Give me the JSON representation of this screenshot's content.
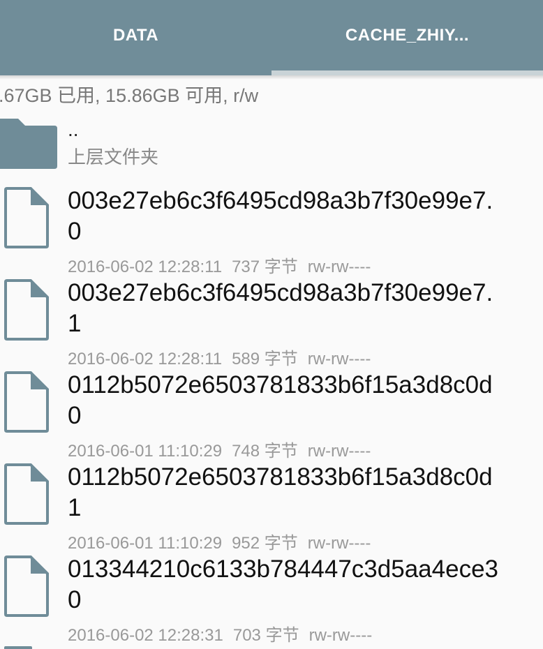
{
  "tabs": {
    "data_label": "DATA",
    "cache_label": "CACHE_ZHIY..."
  },
  "storage_info": ".67GB 已用, 15.86GB 可用, r/w",
  "parent_folder": {
    "name": "..",
    "description": "上层文件夹",
    "icon": "folder-icon"
  },
  "files": [
    {
      "name_line1": "003e27eb6c3f6495cd98a3b7f30e99e7.",
      "name_line2": "0",
      "date": "2016-06-02 12:28:11",
      "size": "737 字节",
      "perms": "rw-rw----",
      "icon": "file-icon"
    },
    {
      "name_line1": "003e27eb6c3f6495cd98a3b7f30e99e7.",
      "name_line2": "1",
      "date": "2016-06-02 12:28:11",
      "size": "589 字节",
      "perms": "rw-rw----",
      "icon": "file-icon"
    },
    {
      "name_line1": "0112b5072e6503781833b6f15a3d8c0d",
      "name_line2": "0",
      "date": "2016-06-01 11:10:29",
      "size": "748 字节",
      "perms": "rw-rw----",
      "icon": "file-icon"
    },
    {
      "name_line1": "0112b5072e6503781833b6f15a3d8c0d",
      "name_line2": "1",
      "date": "2016-06-01 11:10:29",
      "size": "952 字节",
      "perms": "rw-rw----",
      "icon": "file-icon"
    },
    {
      "name_line1": "013344210c6133b784447c3d5aa4ece3",
      "name_line2": "0",
      "date": "2016-06-02 12:28:31",
      "size": "703 字节",
      "perms": "rw-rw----",
      "icon": "file-icon"
    }
  ],
  "colors": {
    "toolbar": "#708d99",
    "icon": "#6f8c98",
    "background": "#fafafa"
  }
}
